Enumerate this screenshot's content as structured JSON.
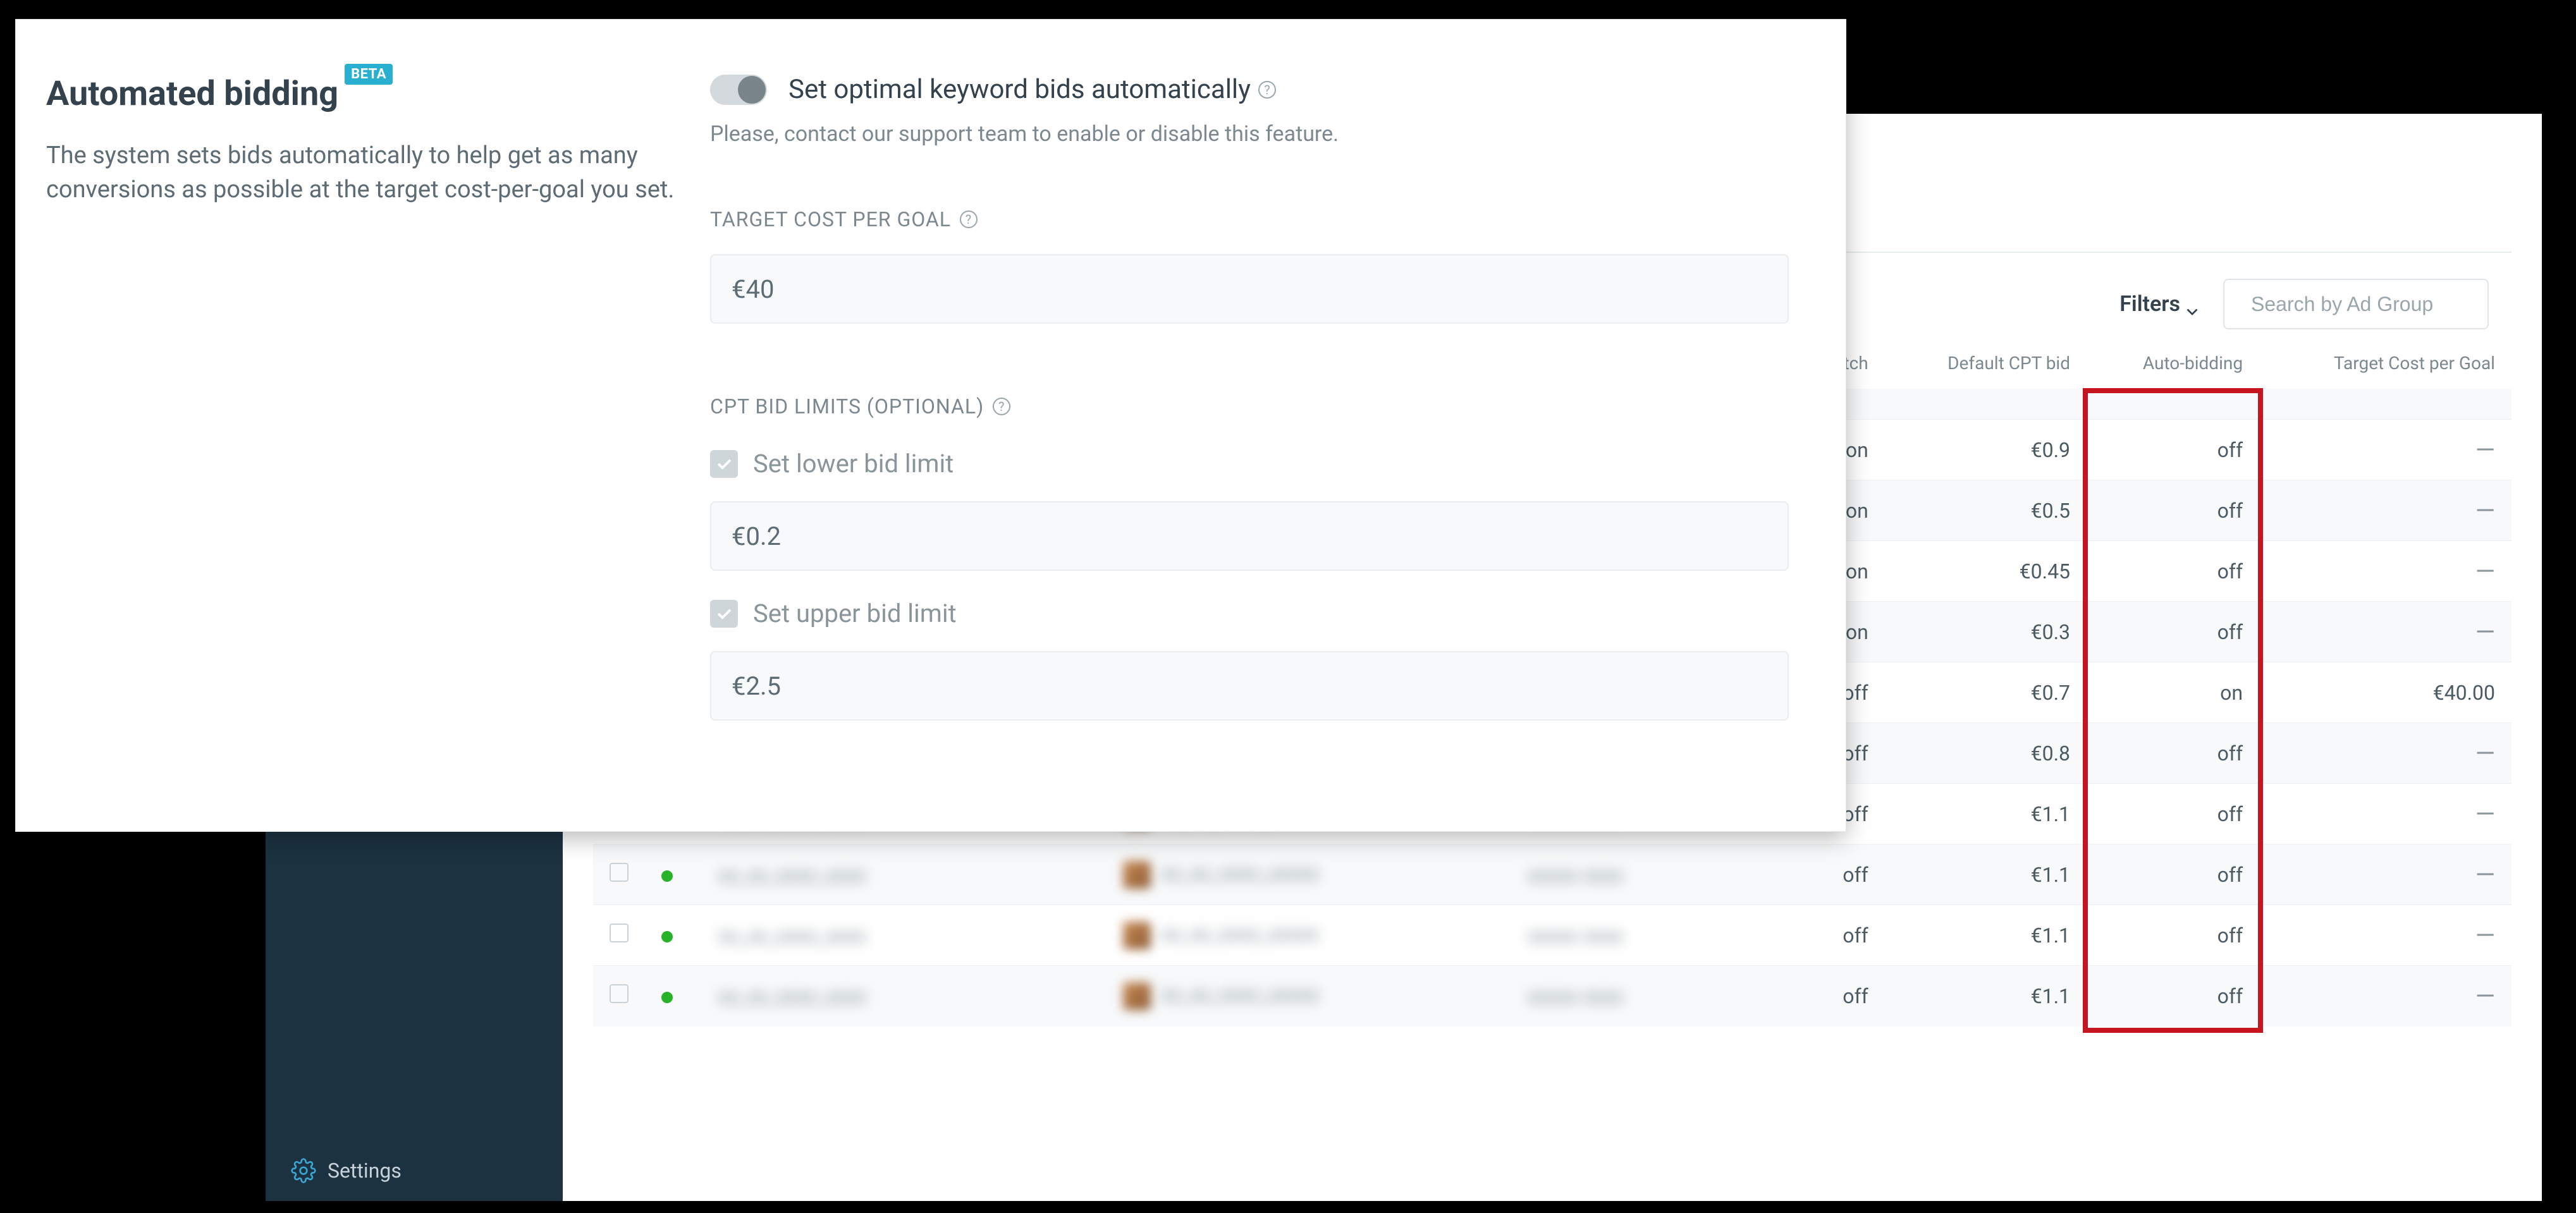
{
  "sidebar": {
    "settings_label": "Settings"
  },
  "toolbar": {
    "filters_label": "Filters",
    "search_placeholder": "Search by Ad Group"
  },
  "table": {
    "headers": {
      "search_match": "Search Match",
      "default_cpt_bid": "Default CPT bid",
      "auto_bidding": "Auto-bidding",
      "target_cpg": "Target Cost per Goal"
    },
    "rows": [
      {
        "search_match": "on",
        "cpt": "€0.9",
        "auto": "off",
        "tcpg": "—"
      },
      {
        "search_match": "on",
        "cpt": "€0.5",
        "auto": "off",
        "tcpg": "—"
      },
      {
        "search_match": "on",
        "cpt": "€0.45",
        "auto": "off",
        "tcpg": "—"
      },
      {
        "search_match": "on",
        "cpt": "€0.3",
        "auto": "off",
        "tcpg": "—"
      },
      {
        "search_match": "off",
        "cpt": "€0.7",
        "auto": "on",
        "tcpg": "€40.00"
      },
      {
        "search_match": "off",
        "cpt": "€0.8",
        "auto": "off",
        "tcpg": "—"
      },
      {
        "search_match": "off",
        "cpt": "€1.1",
        "auto": "off",
        "tcpg": "—"
      },
      {
        "search_match": "off",
        "cpt": "€1.1",
        "auto": "off",
        "tcpg": "—"
      },
      {
        "search_match": "off",
        "cpt": "€1.1",
        "auto": "off",
        "tcpg": "—"
      },
      {
        "search_match": "off",
        "cpt": "€1.1",
        "auto": "off",
        "tcpg": "—"
      }
    ]
  },
  "modal": {
    "title": "Automated bidding",
    "beta_badge": "BETA",
    "description": "The system sets bids automatically to help get as many conversions as possible at the target cost-per-goal you set.",
    "toggle_label": "Set optimal keyword bids automatically",
    "toggle_note": "Please, contact our support team to enable or disable this feature.",
    "tcpg_label": "TARGET COST PER GOAL",
    "tcpg_value": "€40",
    "limits_label": "CPT BID LIMITS (OPTIONAL)",
    "lower_label": "Set lower bid limit",
    "lower_value": "€0.2",
    "upper_label": "Set upper bid limit",
    "upper_value": "€2.5"
  }
}
